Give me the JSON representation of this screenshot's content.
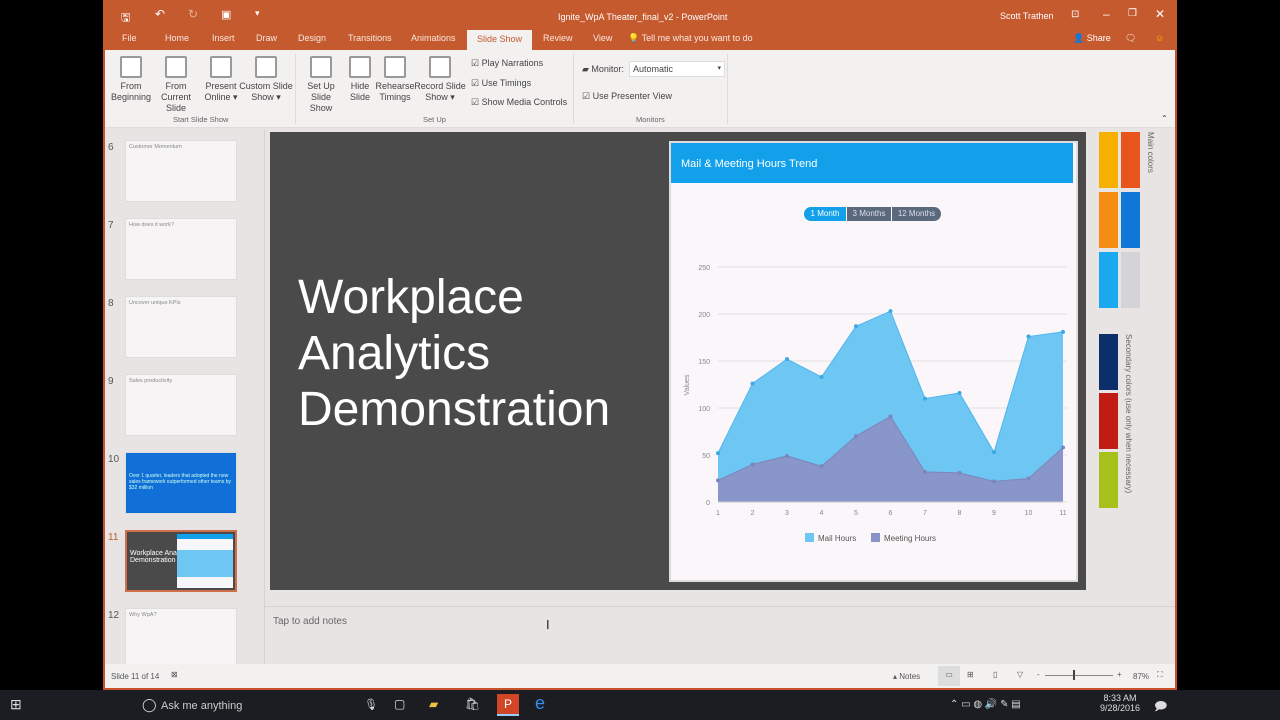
{
  "window": {
    "title": "Ignite_WpA Theater_final_v2  -  PowerPoint",
    "user": "Scott Trathen",
    "share": "Share"
  },
  "tabs": [
    "File",
    "Home",
    "Insert",
    "Draw",
    "Design",
    "Transitions",
    "Animations",
    "Slide Show",
    "Review",
    "View"
  ],
  "tell_me": "Tell me what you want to do",
  "ribbon": {
    "buttons": [
      [
        "From",
        "Beginning"
      ],
      [
        "From",
        "Current Slide"
      ],
      [
        "Present",
        "Online ▾"
      ],
      [
        "Custom Slide",
        "Show ▾"
      ],
      [
        "Set Up",
        "Slide Show"
      ],
      [
        "Hide",
        "Slide"
      ],
      [
        "Rehearse",
        "Timings"
      ],
      [
        "Record Slide",
        "Show ▾"
      ]
    ],
    "checks": [
      "Play Narrations",
      "Use Timings",
      "Show Media Controls"
    ],
    "monitor_label": "Monitor:",
    "monitor_value": "Automatic",
    "presenter_view": "Use Presenter View",
    "groups": [
      "Start Slide Show",
      "Set Up",
      "Monitors"
    ]
  },
  "thumbs": [
    {
      "num": "6",
      "title": "Customer Momentum"
    },
    {
      "num": "7",
      "title": "How does it work?"
    },
    {
      "num": "8",
      "title": "Uncover unique KPIs"
    },
    {
      "num": "9",
      "title": "Sales productivity"
    },
    {
      "num": "10",
      "title": "Over 1 quarter, leaders that adopted the new sales framework outperformed other teams by $32 million"
    },
    {
      "num": "11",
      "title": "Workplace Analytics Demonstration"
    },
    {
      "num": "12",
      "title": "Why WpA?"
    }
  ],
  "slide": {
    "title_lines": [
      "Workplace",
      "Analytics",
      "Demonstration"
    ],
    "card_title": "Mail & Meeting Hours Trend",
    "ranges": [
      "1 Month",
      "3 Months",
      "12 Months"
    ],
    "main_colors": "Main colors",
    "secondary_colors": "Secondary colors (use only when necessary)"
  },
  "chart_data": {
    "type": "area",
    "title": "Mail & Meeting Hours Trend",
    "xlabel": "",
    "ylabel": "Values",
    "x": [
      1,
      2,
      3,
      4,
      5,
      6,
      7,
      8,
      9,
      10,
      11
    ],
    "ylim": [
      0,
      250
    ],
    "yticks": [
      0,
      50,
      100,
      150,
      200,
      250
    ],
    "series": [
      {
        "name": "Mail Hours",
        "color": "#6ec6f3",
        "values": [
          52,
          126,
          152,
          133,
          187,
          203,
          110,
          116,
          53,
          176,
          181
        ]
      },
      {
        "name": "Meeting Hours",
        "color": "#8a93c6",
        "values": [
          23,
          40,
          49,
          38,
          70,
          91,
          32,
          31,
          22,
          25,
          58
        ]
      }
    ],
    "legend": "bottom",
    "grid": true
  },
  "swatches": {
    "main": [
      "#f7b000",
      "#e8541c",
      "#f58c14",
      "#0f78d6",
      "#1aa9ee",
      "#d4d4d8"
    ],
    "secondary": [
      "#0c2f6b",
      "#c01c14",
      "#a7c11c"
    ]
  },
  "notes_placeholder": "Tap to add notes",
  "status": {
    "slide": "Slide 11 of 14",
    "notes": "Notes",
    "zoom": "87%"
  },
  "taskbar": {
    "search": "Ask me anything",
    "time": "8:33 AM",
    "date": "9/28/2016"
  }
}
